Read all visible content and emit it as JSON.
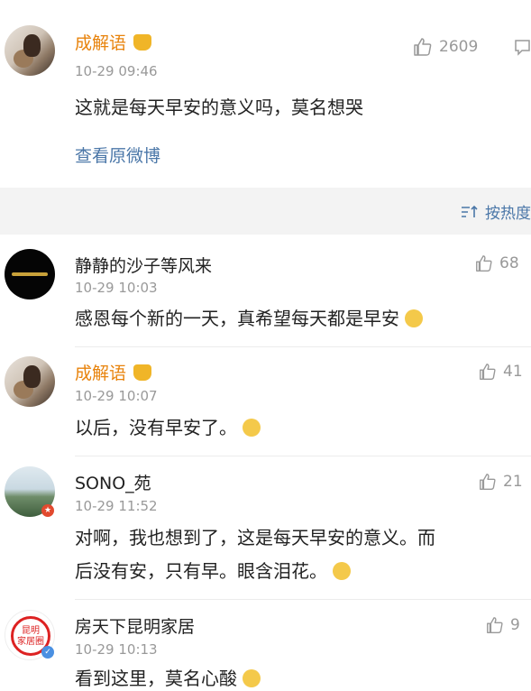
{
  "top_post": {
    "username": "成解语",
    "time": "10-29 09:46",
    "likes": "2609",
    "text": "这就是每天早安的意义吗，莫名想哭",
    "view_original": "查看原微博"
  },
  "sort": {
    "label": "按热度"
  },
  "comments": [
    {
      "username": "静静的沙子等风来",
      "time": "10-29 10:03",
      "likes": "68",
      "text": "感恩每个新的一天，真希望每天都是早安"
    },
    {
      "username": "成解语",
      "time": "10-29 10:07",
      "likes": "41",
      "text": "以后，没有早安了。"
    },
    {
      "username": "SONO_苑",
      "time": "10-29 11:52",
      "likes": "21",
      "text_line1": "对啊，我也想到了，这是每天早安的意义。而",
      "text_line2": "后没有安，只有早。眼含泪花。"
    },
    {
      "username": "房天下昆明家居",
      "time": "10-29 10:13",
      "likes": "9",
      "text": "看到这里，莫名心酸",
      "avatar_text1": "昆明",
      "avatar_text2": "家居圈"
    }
  ],
  "icons": [
    "like-icon",
    "comment-icon",
    "sort-icon",
    "crown-icon",
    "sad-emoji-icon",
    "cry-emoji-icon",
    "verified-icon"
  ],
  "colors": {
    "orange_name": "#e8830c",
    "link": "#4b77a8",
    "gray": "#999999"
  }
}
